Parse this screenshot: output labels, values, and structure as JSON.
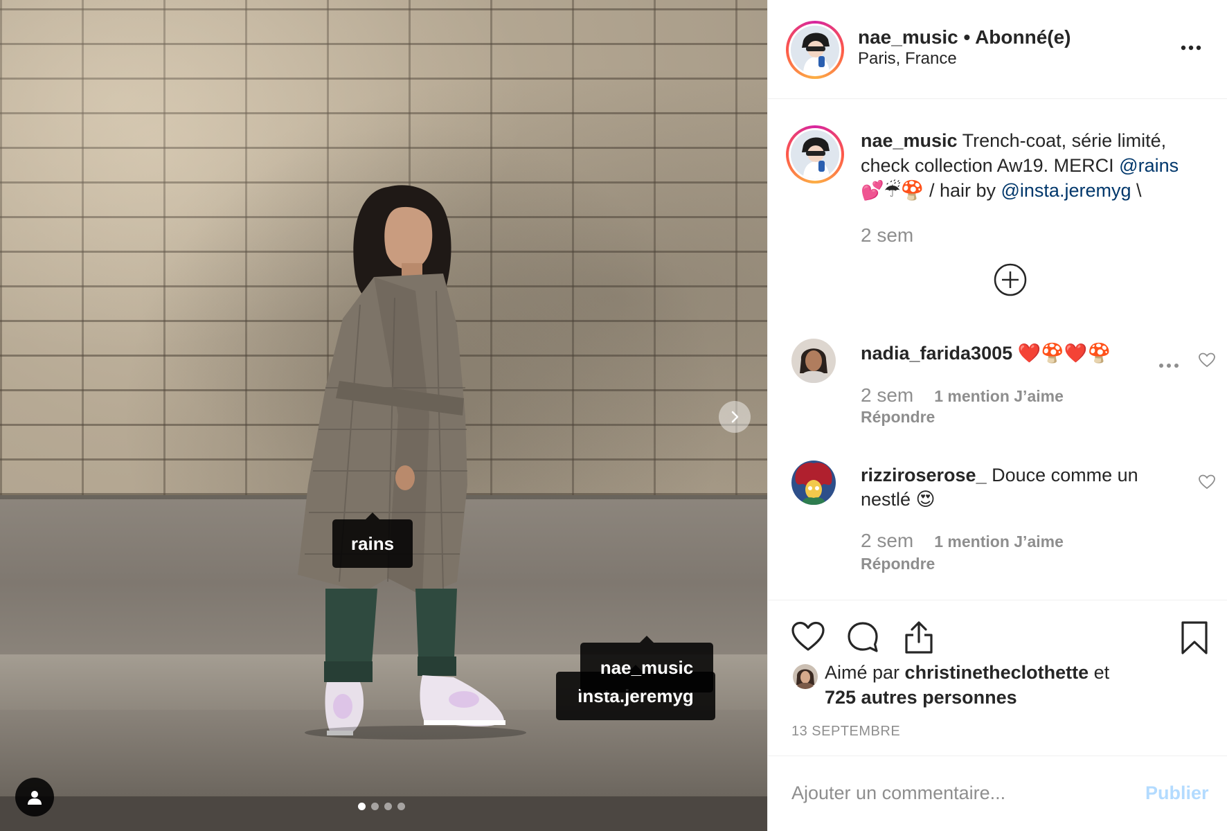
{
  "post": {
    "tags": {
      "rains": "rains",
      "insta": "insta.jeremyg",
      "nae": "nae_music"
    },
    "carousel": {
      "count": 4,
      "active": 1
    }
  },
  "header": {
    "username": "nae_music",
    "separator": " • ",
    "follow_status": "Abonné(e)",
    "location": "Paris, France"
  },
  "caption": {
    "username": "nae_music",
    "text_1": " Trench-coat, série limité, check collection Aw19. MERCI ",
    "mention_1": "@rains",
    "text_2": " 💕☔🍄 / hair by ",
    "mention_2": "@insta.jeremyg",
    "text_3": " \\",
    "time": "2 sem"
  },
  "comments": [
    {
      "username": "nadia_farida3005",
      "text": " ❤️🍄❤️🍄",
      "time": "2 sem",
      "likes": "1 mention J’aime",
      "reply": "Répondre"
    },
    {
      "username": "rizziroserose_",
      "text": " Douce comme un nestlé 😍",
      "time": "2 sem",
      "likes": "1 mention J’aime",
      "reply": "Répondre"
    }
  ],
  "likes": {
    "prefix": "Aimé par ",
    "liker": "christinetheclothette",
    "middle": " et",
    "others": "725 autres personnes"
  },
  "date": "13 SEPTEMBRE",
  "add_comment": {
    "placeholder": "Ajouter un commentaire...",
    "publish": "Publier"
  },
  "colors": {
    "link": "#00376b",
    "secondary": "#8e8e8e",
    "publish_disabled": "#b3dbff"
  }
}
